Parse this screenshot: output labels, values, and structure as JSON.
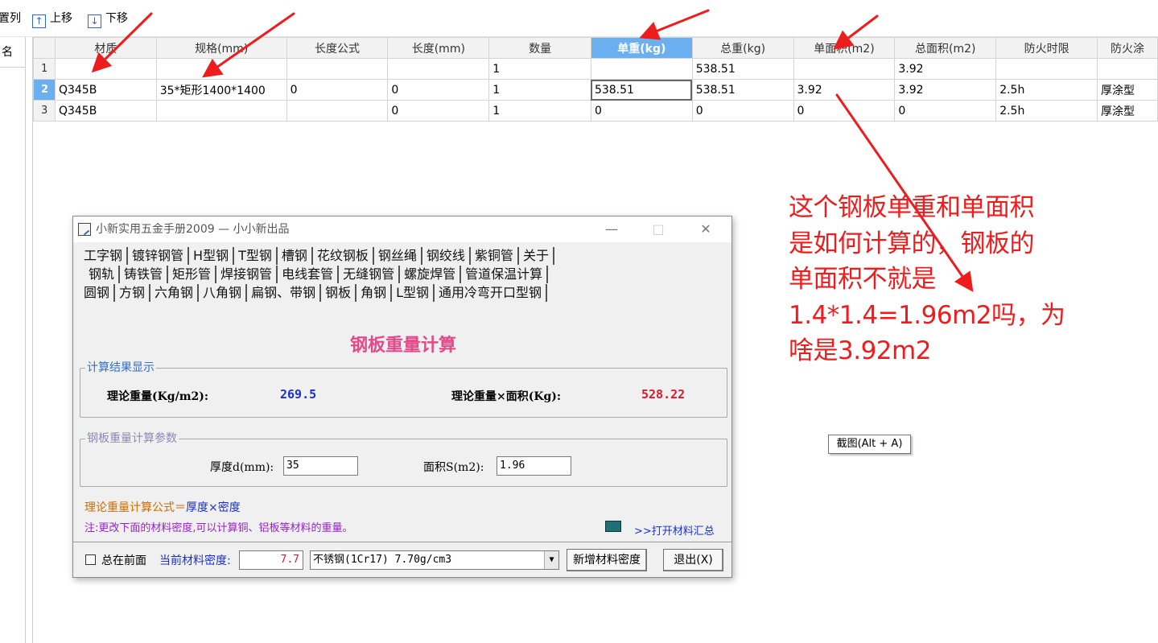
{
  "toolbar": {
    "arrange_label": "置列",
    "move_up_label": "上移",
    "move_down_label": "下移",
    "up_icon": "arrow-up-icon",
    "down_icon": "arrow-down-icon"
  },
  "left_pane": {
    "header": "名"
  },
  "grid": {
    "headers": [
      "材质",
      "规格(mm)",
      "长度公式",
      "长度(mm)",
      "数量",
      "单重(kg)",
      "总重(kg)",
      "单面积(m2)",
      "总面积(m2)",
      "防火时限",
      "防火涂"
    ],
    "rows": [
      {
        "num": "1",
        "cells": [
          "",
          "",
          "",
          "",
          "1",
          "",
          "538.51",
          "",
          "3.92",
          "",
          ""
        ]
      },
      {
        "num": "2",
        "cells": [
          "Q345B",
          "35*矩形1400*1400",
          "0",
          "0",
          "1",
          "538.51",
          "538.51",
          "3.92",
          "3.92",
          "2.5h",
          "厚涂型"
        ]
      },
      {
        "num": "3",
        "cells": [
          "Q345B",
          "",
          "",
          "0",
          "1",
          "0",
          "0",
          "0",
          "0",
          "2.5h",
          "厚涂型"
        ]
      }
    ]
  },
  "annotation": {
    "lines": [
      "这个钢板单重和单面积",
      "是如何计算的，钢板的",
      "单面积不就是",
      "1.4*1.4=1.96m2吗，为",
      "啥是3.92m2"
    ],
    "color": "#ee1c1c"
  },
  "tooltip": "截图(Alt + A)",
  "dialog": {
    "title": "小新实用五金手册2009 — 小小新出品",
    "minimize": "—",
    "maximize": "□",
    "close": "✕",
    "tabs_row1": [
      "工字钢",
      "镀锌钢管",
      "H型钢",
      "T型钢",
      "槽钢",
      "花纹钢板",
      "钢丝绳",
      "钢绞线",
      "紫铜管",
      "关于"
    ],
    "tabs_row2": [
      "钢轨",
      "铸铁管",
      "矩形管",
      "焊接钢管",
      "电线套管",
      "无缝钢管",
      "螺旋焊管",
      "管道保温计算"
    ],
    "tabs_row3": [
      "圆钢",
      "方钢",
      "六角钢",
      "八角钢",
      "扁钢、带钢",
      "钢板",
      "角钢",
      "L型钢",
      "通用冷弯开口型钢"
    ],
    "active_tab": "钢板",
    "panel_title": "钢板重量计算",
    "result_group": "计算结果显示",
    "theory_weight_label": "理论重量(Kg/m2):",
    "theory_weight_value": "269.5",
    "theory_total_label": "理论重量×面积(Kg):",
    "theory_total_value": "528.22",
    "param_group": "钢板重量计算参数",
    "thickness_label": "厚度d(mm):",
    "thickness_value": "35",
    "area_label": "面积S(m2):",
    "area_value": "1.96",
    "formula_label": "理论重量计算公式＝",
    "formula_value": "厚度×密度",
    "note": "注:更改下面的材料密度,可以计算铜、铝板等材料的重量。",
    "open_summary": ">>打开材料汇总",
    "always_on_top": "总在前面",
    "density_label": "当前材料密度:",
    "density_value": "7.7",
    "material_select": "不锈钢(1Cr17) 7.70g/cm3",
    "add_density_btn": "新增材料密度",
    "exit_btn": "退出(X)",
    "colors": {
      "result_blue": "#1a2fd6",
      "result_red": "#e0182d",
      "title_pink": "#e24a8a",
      "formula_orange": "#d26b00",
      "note_purple": "#9a1fd0",
      "group_blue": "#3070c8"
    }
  }
}
